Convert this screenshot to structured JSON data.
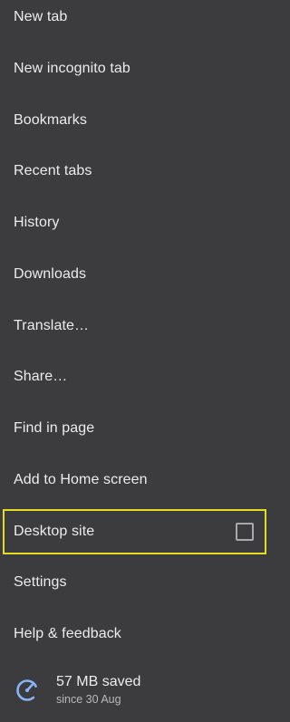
{
  "menu": {
    "items": [
      {
        "label": "New tab"
      },
      {
        "label": "New incognito tab"
      },
      {
        "label": "Bookmarks"
      },
      {
        "label": "Recent tabs"
      },
      {
        "label": "History"
      },
      {
        "label": "Downloads"
      },
      {
        "label": "Translate…"
      },
      {
        "label": "Share…"
      },
      {
        "label": "Find in page"
      },
      {
        "label": "Add to Home screen"
      },
      {
        "label": "Desktop site",
        "checkbox_checked": false
      },
      {
        "label": "Settings"
      },
      {
        "label": "Help & feedback"
      }
    ]
  },
  "data_saver": {
    "icon": "data-saver-gauge-icon",
    "primary": "57 MB saved",
    "secondary": "since 30 Aug"
  },
  "colors": {
    "background": "#3c3c3f",
    "text": "#ececec",
    "highlight": "#e4dc22",
    "accent": "#8ab4f8"
  }
}
